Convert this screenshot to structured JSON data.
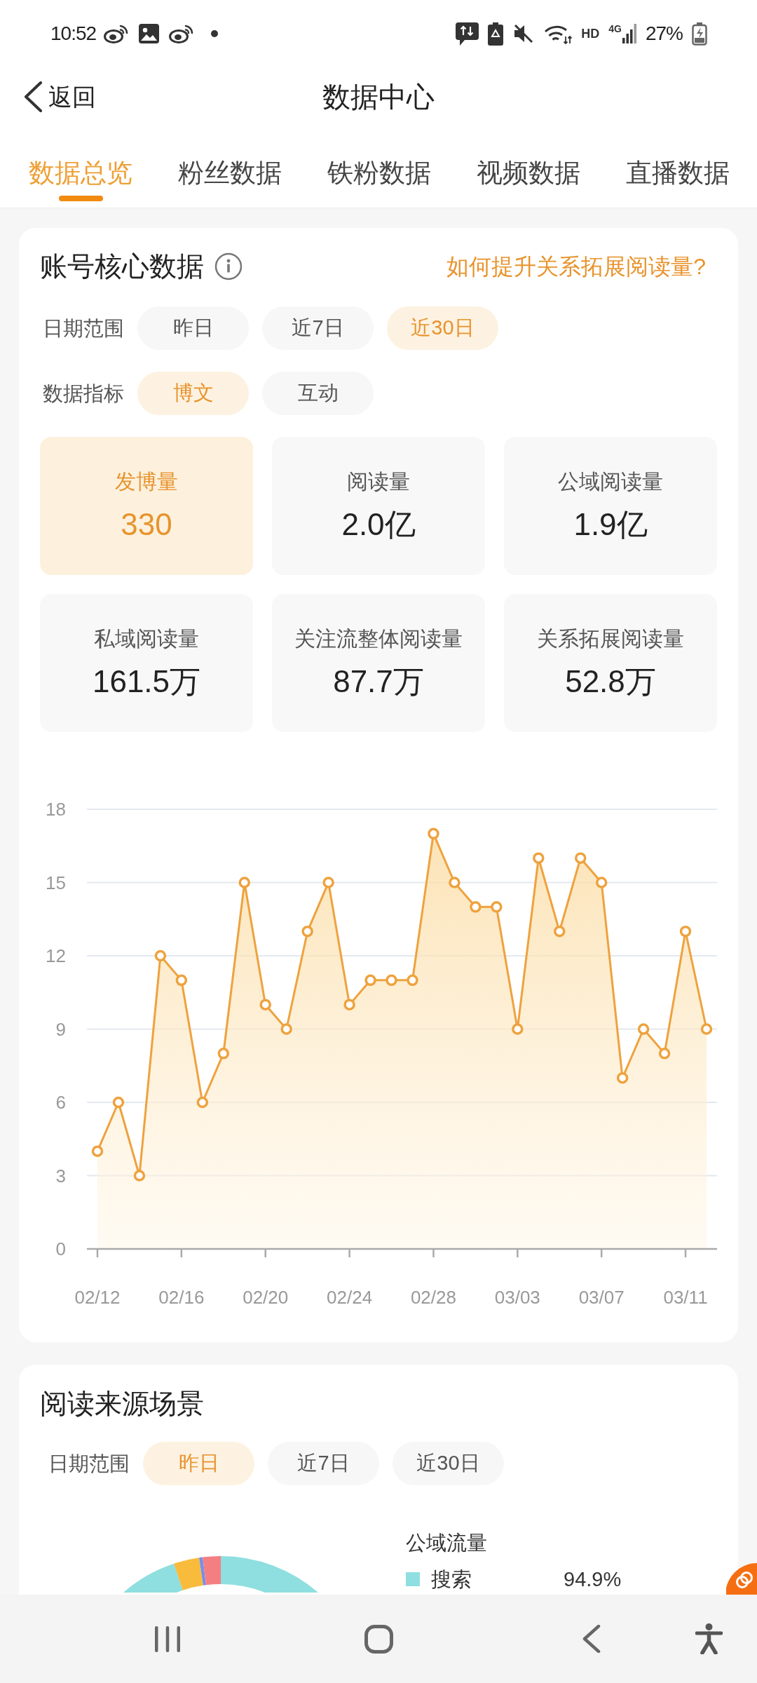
{
  "status_bar": {
    "time": "10:52",
    "network": [
      "HD",
      "4G"
    ],
    "battery": "27%"
  },
  "header": {
    "back_label": "返回",
    "title": "数据中心"
  },
  "tabs": [
    {
      "label": "数据总览",
      "selected": true
    },
    {
      "label": "粉丝数据",
      "selected": false
    },
    {
      "label": "铁粉数据",
      "selected": false
    },
    {
      "label": "视频数据",
      "selected": false
    },
    {
      "label": "直播数据",
      "selected": false
    }
  ],
  "core_card": {
    "title": "账号核心数据",
    "help_link": "如何提升关系拓展阅读量?",
    "filters": [
      {
        "label": "日期范围",
        "options": [
          {
            "label": "昨日",
            "selected": false
          },
          {
            "label": "近7日",
            "selected": false
          },
          {
            "label": "近30日",
            "selected": true
          }
        ]
      },
      {
        "label": "数据指标",
        "options": [
          {
            "label": "博文",
            "selected": true
          },
          {
            "label": "互动",
            "selected": false
          }
        ]
      }
    ],
    "metrics": [
      {
        "label": "发博量",
        "value": "330",
        "selected": true
      },
      {
        "label": "阅读量",
        "value": "2.0亿",
        "selected": false
      },
      {
        "label": "公域阅读量",
        "value": "1.9亿",
        "selected": false
      },
      {
        "label": "私域阅读量",
        "value": "161.5万",
        "selected": false
      },
      {
        "label": "关注流整体阅读量",
        "value": "87.7万",
        "selected": false
      },
      {
        "label": "关系拓展阅读量",
        "value": "52.8万",
        "selected": false
      }
    ],
    "chart_data": {
      "type": "area",
      "categories": [
        "02/12",
        null,
        null,
        null,
        "02/16",
        null,
        null,
        null,
        "02/20",
        null,
        null,
        null,
        "02/24",
        null,
        null,
        null,
        "02/28",
        null,
        null,
        null,
        "03/03",
        null,
        null,
        null,
        "03/07",
        null,
        null,
        null,
        "03/11",
        null
      ],
      "values": [
        4,
        6,
        3,
        12,
        11,
        6,
        8,
        15,
        10,
        9,
        13,
        15,
        10,
        11,
        11,
        11,
        17,
        15,
        14,
        14,
        9,
        16,
        13,
        16,
        15,
        7,
        9,
        8,
        13,
        9
      ],
      "yticks": [
        0,
        3,
        6,
        9,
        12,
        15,
        18
      ],
      "ylim": [
        0,
        18
      ],
      "grid": true
    }
  },
  "source_card": {
    "title": "阅读来源场景",
    "filters": [
      {
        "label": "日期范围",
        "options": [
          {
            "label": "昨日",
            "selected": true
          },
          {
            "label": "近7日",
            "selected": false
          },
          {
            "label": "近30日",
            "selected": false
          }
        ]
      }
    ],
    "legend": {
      "title": "公域流量",
      "items": [
        {
          "label": "搜索",
          "value": "94.9%",
          "color": "#8fdfe0"
        }
      ]
    }
  }
}
